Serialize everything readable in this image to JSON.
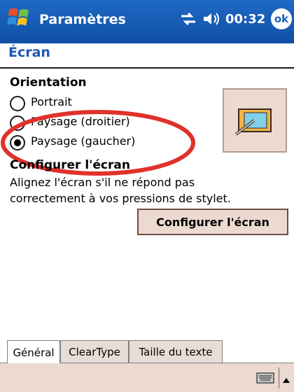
{
  "titlebar": {
    "app_title": "Paramètres",
    "time": "00:32",
    "ok_label": "ok",
    "icons": [
      "windows-start-icon",
      "connectivity-icon",
      "volume-icon"
    ]
  },
  "page": {
    "title": "Écran"
  },
  "orientation": {
    "heading": "Orientation",
    "options": [
      {
        "label": "Portrait",
        "selected": false
      },
      {
        "label": "Paysage (droitier)",
        "selected": false
      },
      {
        "label": "Paysage (gaucher)",
        "selected": true
      }
    ]
  },
  "configure": {
    "heading": "Configurer l'écran",
    "description_line1": "Alignez l'écran s'il ne répond pas",
    "description_line2": "correctement à vos pressions de stylet.",
    "button_label": "Configurer l'écran"
  },
  "tabs": [
    {
      "label": "Général",
      "active": true
    },
    {
      "label": "ClearType",
      "active": false
    },
    {
      "label": "Taille du texte",
      "active": false
    }
  ],
  "colors": {
    "titlebar": "#1a5fb8",
    "accent_text": "#1d57b4",
    "button_bg": "#ecd9cf",
    "annotation_red": "#e0312b"
  }
}
